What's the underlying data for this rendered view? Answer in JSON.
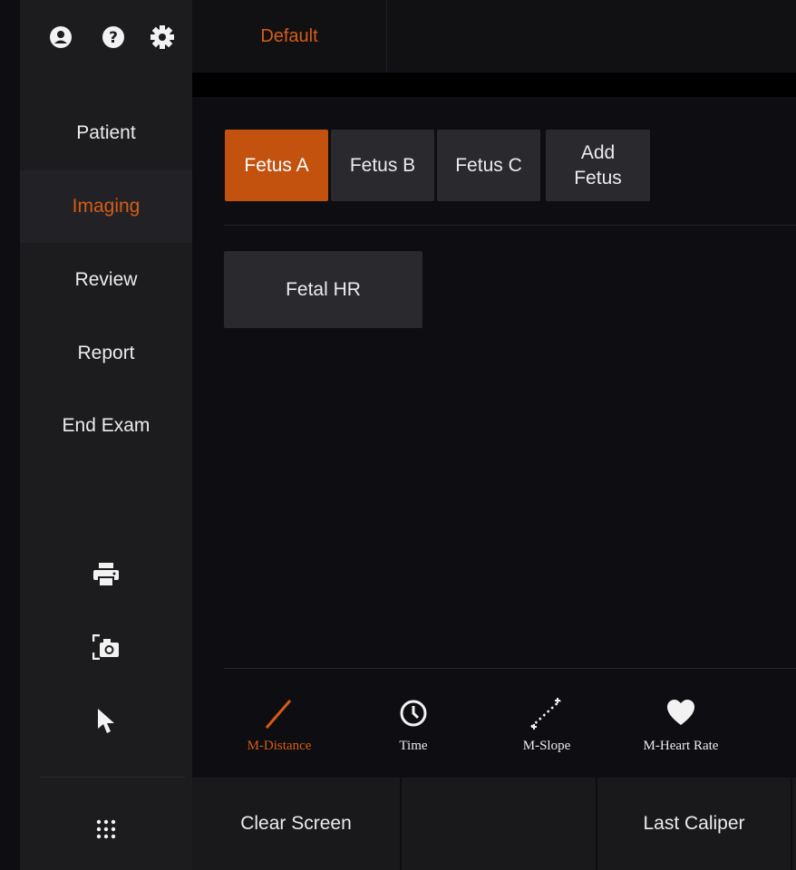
{
  "topbar": {
    "preset": "Default"
  },
  "sidebar": {
    "top_icons": [
      {
        "name": "user-icon"
      },
      {
        "name": "help-icon"
      },
      {
        "name": "settings-gear-icon"
      }
    ],
    "nav": [
      {
        "label": "Patient",
        "active": false
      },
      {
        "label": "Imaging",
        "active": true
      },
      {
        "label": "Review",
        "active": false
      },
      {
        "label": "Report",
        "active": false
      },
      {
        "label": "End Exam",
        "active": false
      }
    ],
    "tools": [
      {
        "name": "print-icon"
      },
      {
        "name": "screenshot-camera-icon"
      },
      {
        "name": "pointer-arrow-icon"
      }
    ],
    "menu_icon": "apps-grid-icon"
  },
  "fetus_tabs": [
    {
      "label": "Fetus A",
      "active": true
    },
    {
      "label": "Fetus B",
      "active": false
    },
    {
      "label": "Fetus C",
      "active": false
    },
    {
      "label": "Add\nFetus",
      "active": false
    }
  ],
  "measurements": [
    {
      "label": "Fetal HR"
    }
  ],
  "calipers": [
    {
      "label": "M-Distance",
      "icon": "line-icon",
      "active": true
    },
    {
      "label": "Time",
      "icon": "clock-icon",
      "active": false
    },
    {
      "label": "M-Slope",
      "icon": "dotted-slope-icon",
      "active": false
    },
    {
      "label": "M-Heart Rate",
      "icon": "heart-icon",
      "active": false
    }
  ],
  "bottom": {
    "clear": "Clear Screen",
    "last": "Last Caliper"
  },
  "colors": {
    "accent": "#d65c14",
    "active_bg": "#c4520f",
    "panel": "#2a2a2e",
    "background": "#0e0e12"
  }
}
